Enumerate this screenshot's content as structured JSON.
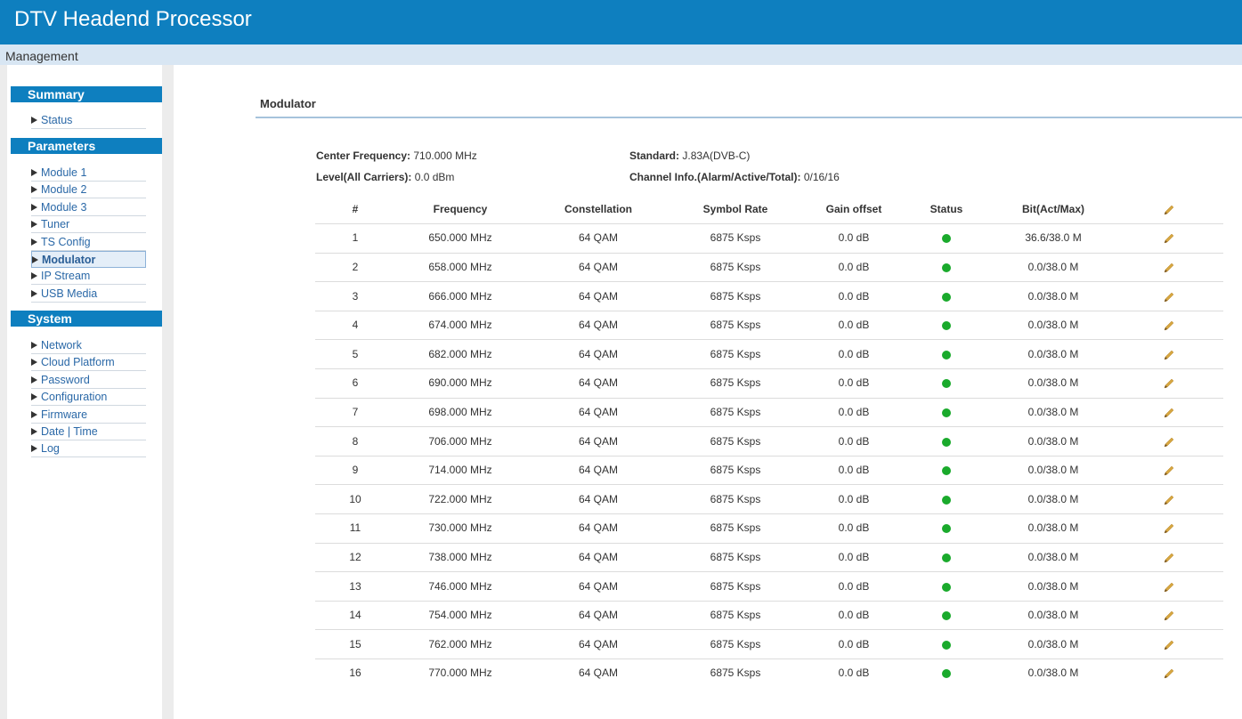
{
  "app": {
    "title": "DTV Headend Processor",
    "breadcrumb": "Management"
  },
  "sidebar": {
    "sections": [
      {
        "label": "Summary",
        "items": [
          {
            "label": "Status"
          }
        ]
      },
      {
        "label": "Parameters",
        "items": [
          {
            "label": "Module 1"
          },
          {
            "label": "Module 2"
          },
          {
            "label": "Module 3"
          },
          {
            "label": "Tuner"
          },
          {
            "label": "TS Config"
          },
          {
            "label": "Modulator",
            "active": true
          },
          {
            "label": "IP Stream"
          },
          {
            "label": "USB Media"
          }
        ]
      },
      {
        "label": "System",
        "items": [
          {
            "label": "Network"
          },
          {
            "label": "Cloud Platform"
          },
          {
            "label": "Password"
          },
          {
            "label": "Configuration"
          },
          {
            "label": "Firmware"
          },
          {
            "label": "Date | Time"
          },
          {
            "label": "Log"
          }
        ]
      }
    ]
  },
  "panel": {
    "title": "Modulator",
    "info": {
      "center_frequency_label": "Center Frequency:",
      "center_frequency_value": "710.000 MHz",
      "standard_label": "Standard:",
      "standard_value": "J.83A(DVB-C)",
      "level_label": "Level(All Carriers):",
      "level_value": "0.0 dBm",
      "channel_info_label": "Channel Info.(Alarm/Active/Total):",
      "channel_info_value": "0/16/16"
    },
    "table": {
      "headers": [
        "#",
        "Frequency",
        "Constellation",
        "Symbol Rate",
        "Gain offset",
        "Status",
        "Bit(Act/Max)",
        ""
      ],
      "rows": [
        [
          "1",
          "650.000 MHz",
          "64 QAM",
          "6875 Ksps",
          "0.0 dB",
          "ok",
          "36.6/38.0 M"
        ],
        [
          "2",
          "658.000 MHz",
          "64 QAM",
          "6875 Ksps",
          "0.0 dB",
          "ok",
          "0.0/38.0 M"
        ],
        [
          "3",
          "666.000 MHz",
          "64 QAM",
          "6875 Ksps",
          "0.0 dB",
          "ok",
          "0.0/38.0 M"
        ],
        [
          "4",
          "674.000 MHz",
          "64 QAM",
          "6875 Ksps",
          "0.0 dB",
          "ok",
          "0.0/38.0 M"
        ],
        [
          "5",
          "682.000 MHz",
          "64 QAM",
          "6875 Ksps",
          "0.0 dB",
          "ok",
          "0.0/38.0 M"
        ],
        [
          "6",
          "690.000 MHz",
          "64 QAM",
          "6875 Ksps",
          "0.0 dB",
          "ok",
          "0.0/38.0 M"
        ],
        [
          "7",
          "698.000 MHz",
          "64 QAM",
          "6875 Ksps",
          "0.0 dB",
          "ok",
          "0.0/38.0 M"
        ],
        [
          "8",
          "706.000 MHz",
          "64 QAM",
          "6875 Ksps",
          "0.0 dB",
          "ok",
          "0.0/38.0 M"
        ],
        [
          "9",
          "714.000 MHz",
          "64 QAM",
          "6875 Ksps",
          "0.0 dB",
          "ok",
          "0.0/38.0 M"
        ],
        [
          "10",
          "722.000 MHz",
          "64 QAM",
          "6875 Ksps",
          "0.0 dB",
          "ok",
          "0.0/38.0 M"
        ],
        [
          "11",
          "730.000 MHz",
          "64 QAM",
          "6875 Ksps",
          "0.0 dB",
          "ok",
          "0.0/38.0 M"
        ],
        [
          "12",
          "738.000 MHz",
          "64 QAM",
          "6875 Ksps",
          "0.0 dB",
          "ok",
          "0.0/38.0 M"
        ],
        [
          "13",
          "746.000 MHz",
          "64 QAM",
          "6875 Ksps",
          "0.0 dB",
          "ok",
          "0.0/38.0 M"
        ],
        [
          "14",
          "754.000 MHz",
          "64 QAM",
          "6875 Ksps",
          "0.0 dB",
          "ok",
          "0.0/38.0 M"
        ],
        [
          "15",
          "762.000 MHz",
          "64 QAM",
          "6875 Ksps",
          "0.0 dB",
          "ok",
          "0.0/38.0 M"
        ],
        [
          "16",
          "770.000 MHz",
          "64 QAM",
          "6875 Ksps",
          "0.0 dB",
          "ok",
          "0.0/38.0 M"
        ]
      ]
    }
  },
  "icons": {
    "status": "status-ok-dot-icon",
    "edit": "pencil-edit-icon"
  },
  "colors": {
    "header": "#0e7fbf",
    "status_ok": "#1aaa2c",
    "link": "#2a68a7",
    "edit_pencil": "#d6a640"
  }
}
